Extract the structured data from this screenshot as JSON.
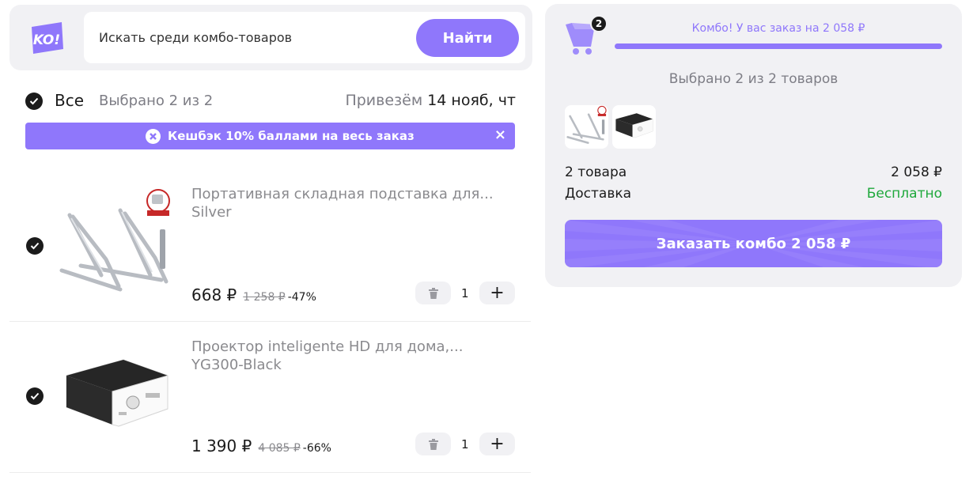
{
  "search": {
    "logo_text": "KO!",
    "placeholder": "Искать среди комбо-товаров",
    "button_label": "Найти"
  },
  "selection": {
    "all_label": "Все",
    "selected_count": "Выбрано 2 из 2",
    "delivery_prefix": "Привезём",
    "delivery_date": "14 нояб, чт"
  },
  "cashback": {
    "text": "Кешбэк 10% баллами на весь заказ",
    "close_icon": "×"
  },
  "products": [
    {
      "title": "Портативная складная подставка для...",
      "variant": "Silver",
      "price": "668 ₽",
      "old_price": "1 258 ₽",
      "discount": "-47%",
      "quantity": "1",
      "image": "laptop-stand-image"
    },
    {
      "title": "Проектор inteligente HD для дома,...",
      "variant": "YG300-Black",
      "price": "1 390 ₽",
      "old_price": "4 085 ₽",
      "discount": "-66%",
      "quantity": "1",
      "image": "projector-image"
    }
  ],
  "summary": {
    "cart_count": "2",
    "combo_text": "Комбо! У вас заказ на 2 058 ₽",
    "progress": 1.0,
    "selected_text": "Выбрано 2 из 2 товаров",
    "items_label": "2 товара",
    "items_value": "2 058 ₽",
    "delivery_label": "Доставка",
    "delivery_value": "Бесплатно",
    "order_button": "Заказать комбо  2 058 ₽"
  },
  "colors": {
    "accent": "#8f77fb",
    "panel_bg": "#f1f1f4",
    "free_green": "#1ea83b"
  }
}
